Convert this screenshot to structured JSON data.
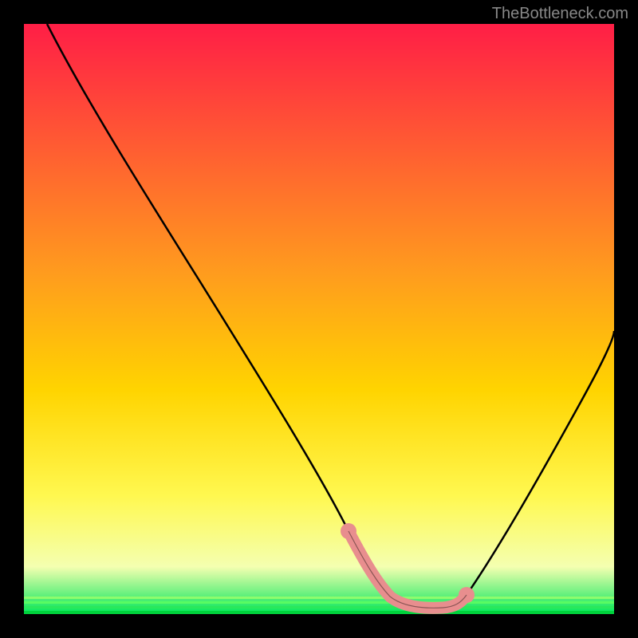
{
  "watermark": "TheBottleneck.com",
  "chart_data": {
    "type": "line",
    "title": "",
    "xlabel": "",
    "ylabel": "",
    "xlim": [
      0,
      100
    ],
    "ylim": [
      0,
      100
    ],
    "background_gradient": {
      "top": "#FF1E46",
      "mid": "#FFD400",
      "low": "#FFFF7A",
      "bottom": "#00E65A"
    },
    "series": [
      {
        "name": "curve",
        "color": "#000000",
        "x": [
          4,
          10,
          20,
          30,
          40,
          50,
          55,
          58,
          62,
          66,
          70,
          74,
          80,
          88,
          96,
          100
        ],
        "values": [
          100,
          88,
          72,
          56,
          40,
          24,
          14,
          8,
          3,
          2,
          2,
          2,
          6,
          20,
          38,
          48
        ]
      },
      {
        "name": "highlight",
        "color": "#E88E8E",
        "x": [
          55,
          58,
          62,
          66,
          70,
          74
        ],
        "values": [
          14,
          8,
          3,
          2,
          2,
          2
        ]
      }
    ]
  }
}
